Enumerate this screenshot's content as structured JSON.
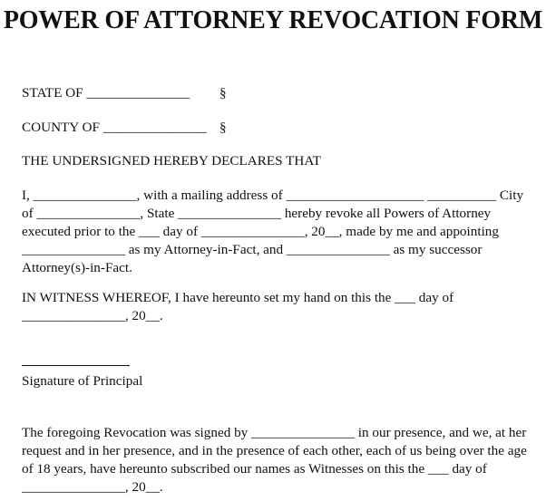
{
  "document": {
    "title": "POWER OF ATTORNEY REVOCATION FORM",
    "jurisdiction": {
      "state_label": "STATE OF _______________",
      "state_section_symbol": "§",
      "county_label": "COUNTY OF _______________",
      "county_section_symbol": "§"
    },
    "declaration_heading": "THE UNDERSIGNED HEREBY DECLARES THAT",
    "revocation_paragraph": "I, _______________, with a mailing address of ____________________ __________ City of _______________, State _______________ hereby revoke all Powers of Attorney executed prior to the ___ day of _______________, 20__, made by me and appointing _______________ as my Attorney-in-Fact, and _______________ as my successor Attorney(s)-in-Fact.",
    "witness_clause_paragraph": "IN WITNESS WHEREOF, I have hereunto set my hand on this the ___ day of _______________, 20__.",
    "signature_block": {
      "rule": "signature-line",
      "caption": "Signature of Principal"
    },
    "attestation_paragraph": "The foregoing Revocation was signed by _______________ in our presence, and we, at her request and in her presence, and in the presence of each other, each of us being over the age of 18 years, have hereunto subscribed our names as Witnesses on this the ___ day of _______________, 20__."
  },
  "colors": {
    "page_background": "#ffffff",
    "text": "#111111",
    "rule": "#111111"
  }
}
